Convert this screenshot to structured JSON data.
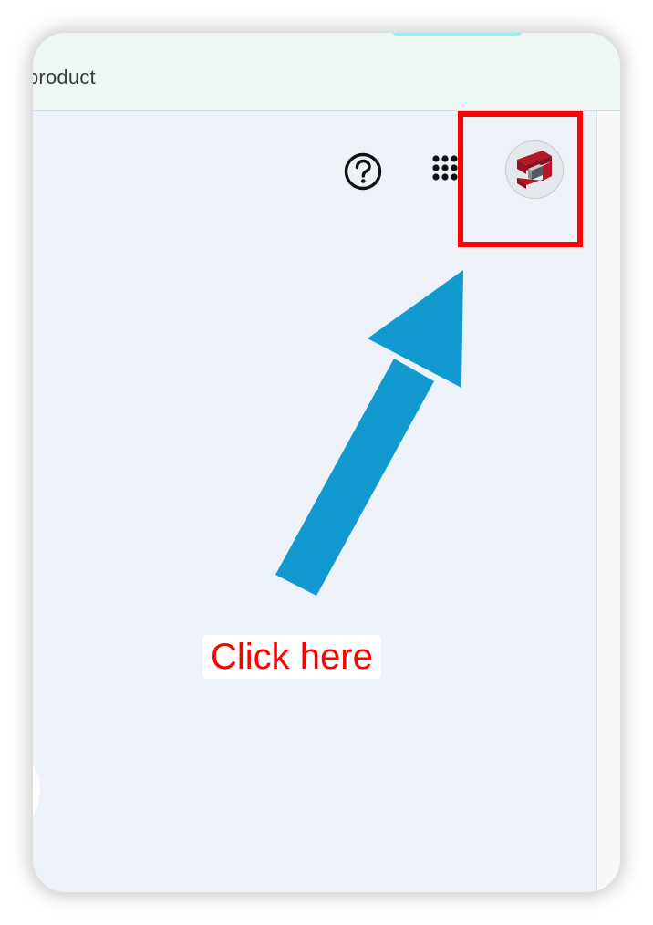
{
  "header": {
    "partial_title": "product"
  },
  "toolbar": {
    "help_icon": "help-circle-icon",
    "apps_icon": "apps-grid-icon",
    "avatar_logo": "brand-s-logo"
  },
  "annotation": {
    "callout_text": "Click here",
    "arrow_color": "#1299cf",
    "highlight_color": "#ff0000"
  },
  "colors": {
    "topbar_bg": "#eef7f4",
    "content_bg": "#edf2f8",
    "accent_teal": "#9af0ea",
    "logo_red": "#b5172a"
  }
}
